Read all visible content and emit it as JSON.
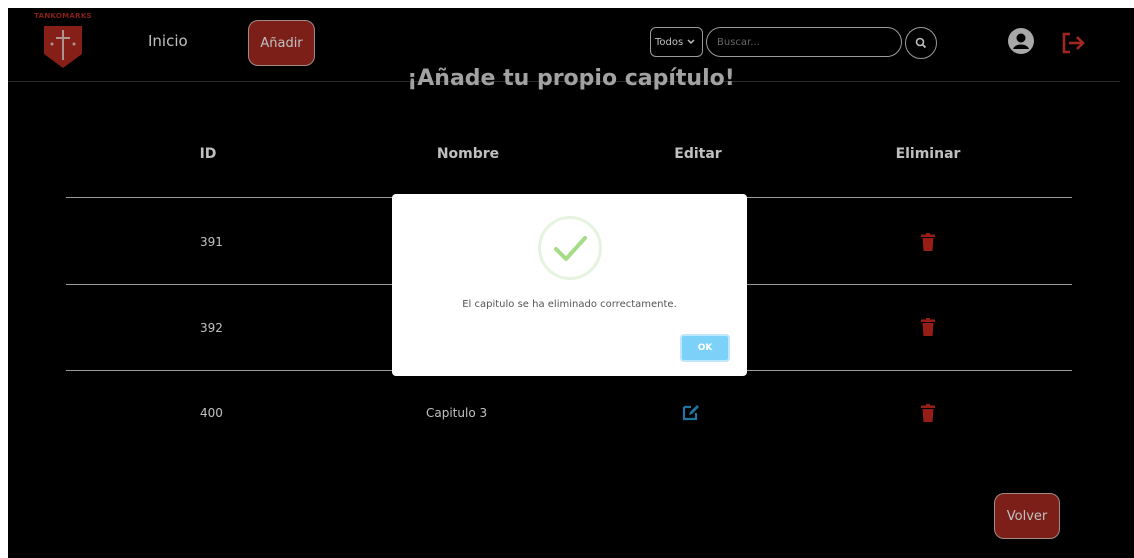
{
  "brand": {
    "name": "TANKOMARKS"
  },
  "nav": {
    "home": "Inicio",
    "add": "Añadir"
  },
  "search": {
    "filter": "Todos",
    "placeholder": "Buscar..."
  },
  "page": {
    "title": "¡Añade tu propio capítulo!"
  },
  "table": {
    "headers": [
      "ID",
      "Nombre",
      "Editar",
      "Eliminar"
    ],
    "rows": [
      {
        "id": "391",
        "name": ""
      },
      {
        "id": "392",
        "name": ""
      },
      {
        "id": "400",
        "name": "Capitulo 3"
      }
    ]
  },
  "footer": {
    "back": "Volver"
  },
  "modal": {
    "message": "El capitulo se ha eliminado correctamente.",
    "ok": "OK"
  },
  "colors": {
    "accent_red": "#a62a22",
    "edit_blue": "#2a9bd6",
    "ok_blue": "#7cd1f9",
    "success_green": "#a5dc86"
  }
}
